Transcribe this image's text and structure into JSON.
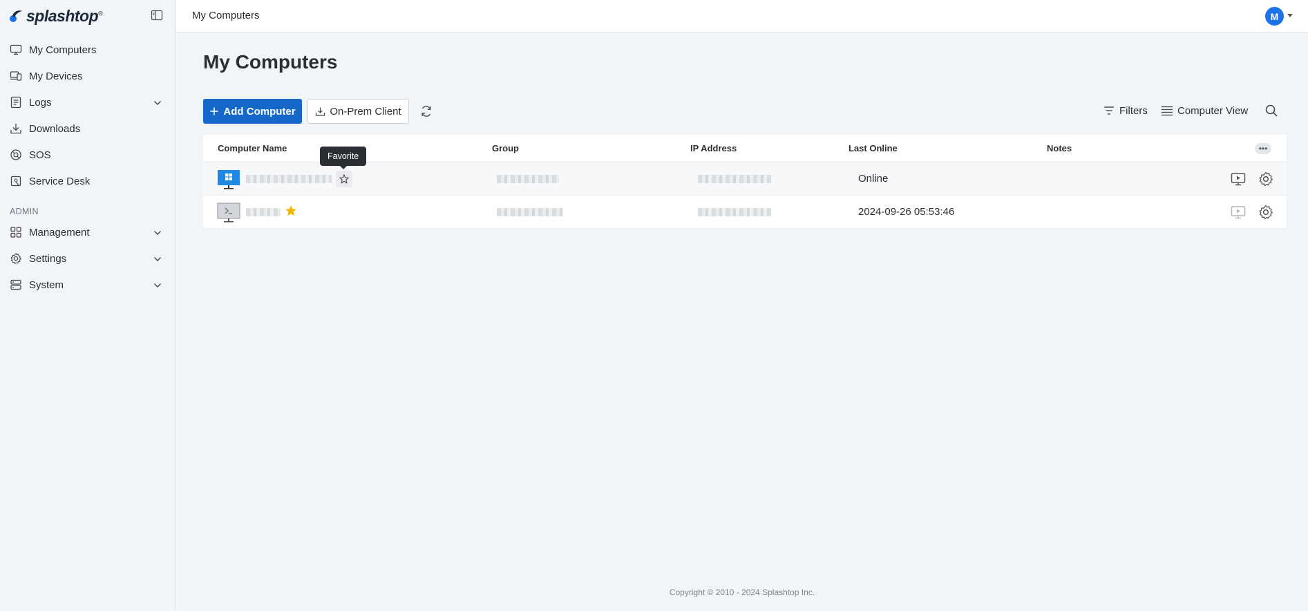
{
  "brand": {
    "name": "splashtop",
    "mark": "®"
  },
  "sidebar": {
    "items": [
      {
        "label": "My Computers",
        "icon": "monitor-icon"
      },
      {
        "label": "My Devices",
        "icon": "devices-icon"
      },
      {
        "label": "Logs",
        "icon": "logs-icon",
        "expandable": true
      },
      {
        "label": "Downloads",
        "icon": "download-icon"
      },
      {
        "label": "SOS",
        "icon": "sos-icon"
      },
      {
        "label": "Service Desk",
        "icon": "service-desk-icon"
      }
    ],
    "admin_label": "ADMIN",
    "admin_items": [
      {
        "label": "Management",
        "icon": "grid-icon",
        "expandable": true
      },
      {
        "label": "Settings",
        "icon": "gear-icon",
        "expandable": true
      },
      {
        "label": "System",
        "icon": "server-icon",
        "expandable": true
      }
    ]
  },
  "topbar": {
    "title": "My Computers",
    "avatar_initial": "M"
  },
  "main": {
    "title": "My Computers",
    "toolbar": {
      "add_label": "Add Computer",
      "onprem_label": "On-Prem Client",
      "filters_label": "Filters",
      "view_label": "Computer View"
    },
    "table": {
      "columns": [
        "Computer Name",
        "Group",
        "IP Address",
        "Last Online",
        "Notes"
      ],
      "rows": [
        {
          "os": "windows",
          "favorite": false,
          "last_online": "Online"
        },
        {
          "os": "terminal",
          "favorite": true,
          "last_online": "2024-09-26 05:53:46"
        }
      ]
    },
    "tooltip": "Favorite"
  },
  "footer": {
    "copyright": "Copyright © 2010 - 2024 Splashtop Inc."
  },
  "colors": {
    "primary": "#1668c8",
    "avatar": "#1a73e8",
    "favorite": "#f5b800"
  }
}
